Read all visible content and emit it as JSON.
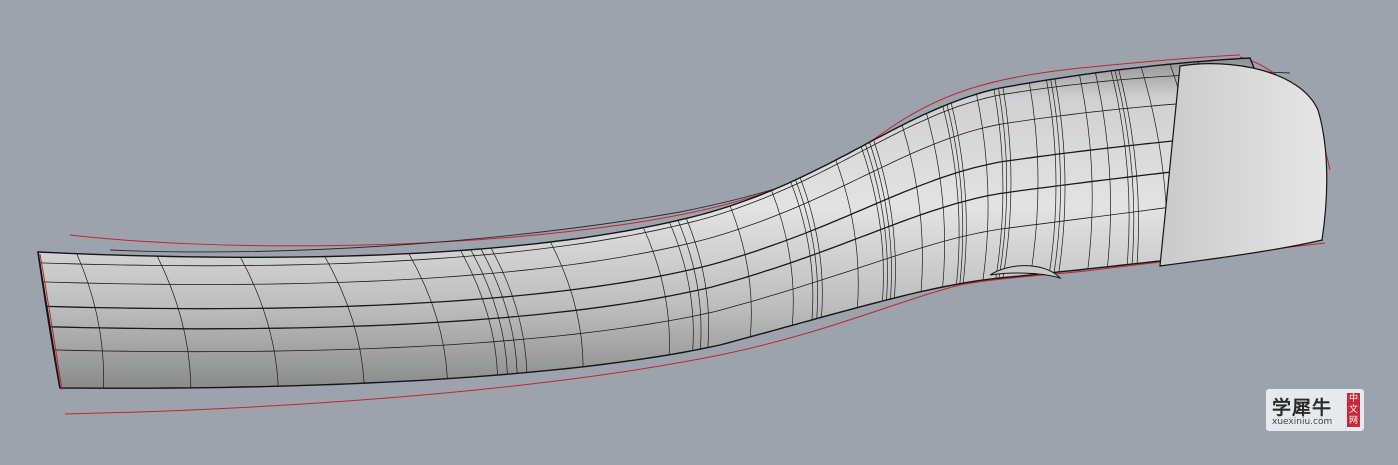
{
  "viewport": {
    "background_color": "#9ca3ad",
    "surface_color": "#d4d5d6",
    "wire_color": "#1a1a1a",
    "curve_color": "#c0262c"
  },
  "watermark": {
    "title": "学犀牛",
    "url": "xuexiniu.com",
    "badge_chars": [
      "中",
      "文",
      "网"
    ],
    "badge_color": "#c8283a"
  }
}
